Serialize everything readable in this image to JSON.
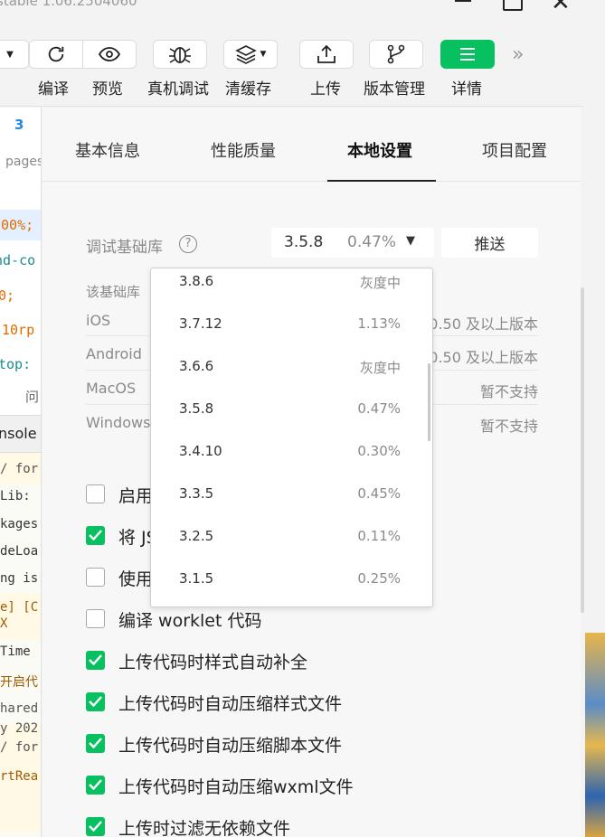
{
  "window": {
    "title": "stable 1.06.2504060",
    "controls": {
      "minimize_icon": "minimize-icon",
      "maximize_icon": "maximize-icon",
      "close_icon": "close-icon"
    }
  },
  "toolbar": {
    "items": [
      {
        "label": "编译",
        "icon": "refresh-icon"
      },
      {
        "label": "预览",
        "icon": "eye-icon"
      },
      {
        "label": "真机调试",
        "icon": "bug-icon"
      },
      {
        "label": "清缓存",
        "icon": "layers-icon"
      },
      {
        "label": "上传",
        "icon": "upload-icon"
      },
      {
        "label": "版本管理",
        "icon": "branch-icon"
      },
      {
        "label": "详情",
        "icon": "menu-icon"
      }
    ],
    "more_icon": "double-chevron-right-icon"
  },
  "editor": {
    "css_badge": "3",
    "path_fragment": "pages",
    "code_lines": [
      "100%;",
      "nd-co",
      "0;",
      "10rp",
      "top:"
    ],
    "panel_tab": "问",
    "console_tab": "nsole",
    "log_lines": [
      "/ for",
      "Lib:",
      "kages",
      "deLoa",
      "ng is",
      "e] [C",
      "X",
      " Time",
      "开启代",
      "hared",
      "y 202",
      "/ for",
      "rtRea"
    ]
  },
  "settings": {
    "tabs": [
      "基本信息",
      "性能质量",
      "本地设置",
      "项目配置"
    ],
    "active_tab": 2,
    "base_lib": {
      "label": "调试基础库",
      "selected_version": "3.5.8",
      "selected_percent": "0.47%",
      "push_button": "推送"
    },
    "support_note": "该基础库",
    "platforms": [
      {
        "name": "iOS",
        "value": "0.50 及以上版本"
      },
      {
        "name": "Android",
        "value": "0.50 及以上版本"
      },
      {
        "name": "MacOS",
        "value": "暂不支持"
      },
      {
        "name": "Windows",
        "value": "暂不支持"
      }
    ],
    "options": [
      {
        "label": "启用",
        "checked": false
      },
      {
        "label": "将 JS",
        "checked": true
      },
      {
        "label": "使用",
        "checked": false
      },
      {
        "label": "编译 worklet 代码",
        "checked": false
      },
      {
        "label": "上传代码时样式自动补全",
        "checked": true
      },
      {
        "label": "上传代码时自动压缩样式文件",
        "checked": true
      },
      {
        "label": "上传代码时自动压缩脚本文件",
        "checked": true
      },
      {
        "label": "上传代码时自动压缩wxml文件",
        "checked": true
      },
      {
        "label": "上传时过滤无依赖文件",
        "checked": true
      }
    ],
    "version_dropdown": [
      {
        "version": "3.8.6",
        "percent": "灰度中"
      },
      {
        "version": "3.7.12",
        "percent": "1.13%"
      },
      {
        "version": "3.6.6",
        "percent": "灰度中"
      },
      {
        "version": "3.5.8",
        "percent": "0.47%"
      },
      {
        "version": "3.4.10",
        "percent": "0.30%"
      },
      {
        "version": "3.3.5",
        "percent": "0.45%"
      },
      {
        "version": "3.2.5",
        "percent": "0.11%"
      },
      {
        "version": "3.1.5",
        "percent": "0.25%"
      }
    ]
  },
  "colors": {
    "accent_green": "#07c160",
    "css_badge_blue": "#1e88e5",
    "code_orange": "#e06c00",
    "code_teal": "#1a8f8f",
    "code_purple": "#b000b0"
  }
}
